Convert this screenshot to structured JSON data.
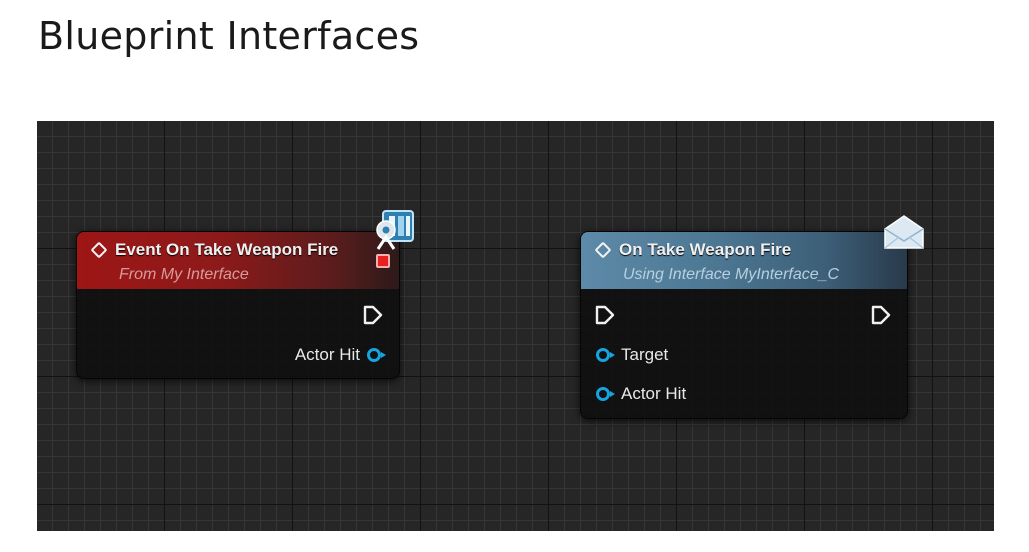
{
  "page": {
    "title": "Blueprint Interfaces"
  },
  "colors": {
    "event_header": "#9e1616",
    "call_header": "#5d8aa8",
    "data_pin": "#16a4e0",
    "delegate_pin": "#e82020",
    "graph_background": "#262626"
  },
  "event_node": {
    "title": "Event On Take Weapon Fire",
    "subtitle": "From My Interface",
    "badge_icon": "interface-event-icon",
    "outputs": {
      "exec_icon": "exec-pin-icon",
      "actor_hit_label": "Actor Hit"
    }
  },
  "call_node": {
    "title": "On Take Weapon Fire",
    "subtitle": "Using Interface MyInterface_C",
    "badge_icon": "envelope-icon",
    "inputs": {
      "exec_icon": "exec-pin-icon",
      "target_label": "Target",
      "actor_hit_label": "Actor Hit"
    },
    "outputs": {
      "exec_icon": "exec-pin-icon"
    }
  }
}
